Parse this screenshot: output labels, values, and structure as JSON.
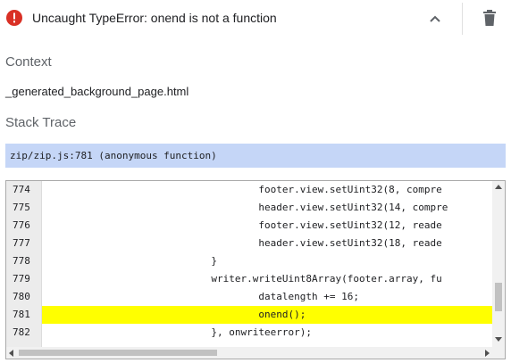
{
  "error": {
    "title": "Uncaught TypeError: onend is not a function"
  },
  "context": {
    "heading": "Context",
    "value": "_generated_background_page.html"
  },
  "stack_trace": {
    "heading": "Stack Trace",
    "frame": "zip/zip.js:781 (anonymous function)"
  },
  "code": {
    "highlighted_line": "781",
    "lines": [
      {
        "num": "774",
        "text": "                                    footer.view.setUint32(8, compre"
      },
      {
        "num": "775",
        "text": "                                    header.view.setUint32(14, compre"
      },
      {
        "num": "776",
        "text": "                                    footer.view.setUint32(12, reade"
      },
      {
        "num": "777",
        "text": "                                    header.view.setUint32(18, reade"
      },
      {
        "num": "778",
        "text": "                            }"
      },
      {
        "num": "779",
        "text": "                            writer.writeUint8Array(footer.array, fu"
      },
      {
        "num": "780",
        "text": "                                    datalength += 16;"
      },
      {
        "num": "781",
        "text": "                                    onend();"
      },
      {
        "num": "782",
        "text": "                            }, onwriteerror);"
      }
    ]
  },
  "colors": {
    "error_red": "#d93025",
    "trace_highlight": "#c5d6f7",
    "line_highlight": "#ffff00"
  }
}
